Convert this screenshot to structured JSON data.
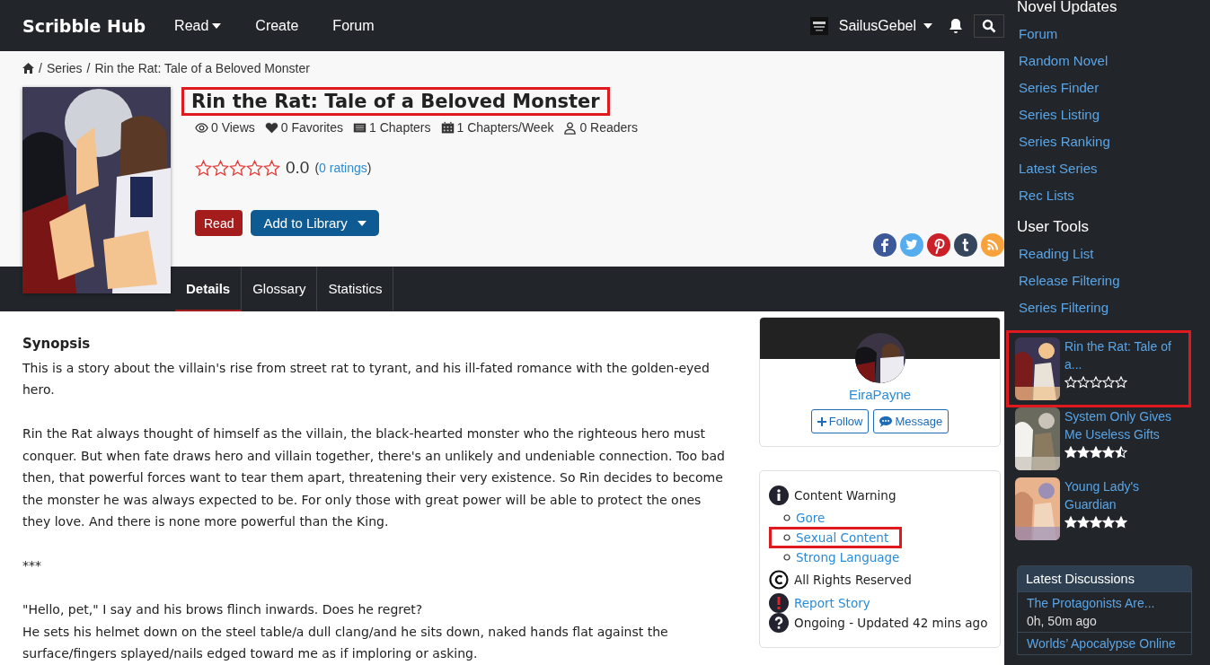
{
  "nav": {
    "brand": "Scribble Hub",
    "menu": [
      {
        "label": "Read",
        "dropdown": true
      },
      {
        "label": "Create",
        "dropdown": false
      },
      {
        "label": "Forum",
        "dropdown": false
      }
    ],
    "user": "SailusGebel"
  },
  "breadcrumb": [
    {
      "separator": "/",
      "label": "Series"
    },
    {
      "separator": "/",
      "label": "Rin the Rat: Tale of a Beloved Monster"
    }
  ],
  "series": {
    "title": "Rin the Rat: Tale of a Beloved Monster",
    "highlighted": true,
    "stats": [
      {
        "kind": "views",
        "text": "0 Views"
      },
      {
        "kind": "favorites",
        "text": "0 Favorites"
      },
      {
        "kind": "chapters",
        "text": "1 Chapters"
      },
      {
        "kind": "schedule",
        "text": "1 Chapters/Week"
      },
      {
        "kind": "readers",
        "text": "0 Readers"
      }
    ],
    "stars": 0,
    "rating": "0.0",
    "ratings_open": "(",
    "ratings_link": "0 ratings",
    "ratings_close": ")",
    "read_button": "Read",
    "library_button": "Add to Library"
  },
  "tabs": [
    {
      "label": "Details",
      "selected": true
    },
    {
      "label": "Glossary",
      "selected": false
    },
    {
      "label": "Statistics",
      "selected": false
    }
  ],
  "synopsis": {
    "heading": "Synopsis",
    "paragraphs": [
      [
        "This is a story about the villain's rise from street rat to tyrant, and his ill-fated romance with the golden-eyed hero."
      ],
      [
        "Rin the Rat always thought of himself as the villain, the black-hearted monster who the righteous hero must conquer. But when fate draws hero and villain together, there's an unlikely and undeniable connection. Too bad then, that powerful forces want to tear them apart, threatening their very existence. So Rin decides to become the monster he was always expected to be. For only those with great power will be able to protect the ones they love. And there is none more powerful than the King."
      ],
      [
        "***"
      ],
      [
        "\"Hello, pet,\" I say and his brows flinch inwards. Does he regret?",
        "He sets his helmet down on the steel table/a dull clang/and he sits down, naked hands flat against the surface/fingers splayed/nails edged toward me as if imploring or asking."
      ]
    ]
  },
  "author": {
    "name": "EiraPayne",
    "follow": "Follow",
    "message": "Message"
  },
  "info": {
    "warning_title": "Content Warning",
    "warnings": [
      {
        "label": "Gore",
        "highlighted": false
      },
      {
        "label": "Sexual Content",
        "highlighted": true
      },
      {
        "label": "Strong Language",
        "highlighted": false
      }
    ],
    "license": "All Rights Reserved",
    "report": "Report Story",
    "status": "Ongoing - Updated 42 mins ago"
  },
  "sidebar": {
    "sections": [
      {
        "heading": "Novel Updates",
        "links": [
          "Forum",
          "Random Novel",
          "Series Finder",
          "Series Listing",
          "Series Ranking",
          "Latest Series",
          "Rec Lists"
        ]
      },
      {
        "heading": "User Tools",
        "links": [
          "Reading List",
          "Release Filtering",
          "Series Filtering"
        ]
      }
    ],
    "novels": [
      {
        "title": "Rin the Rat: Tale of a...",
        "stars": 0,
        "highlighted": true
      },
      {
        "title": "System Only Gives Me Useless Gifts",
        "stars": 4.5,
        "highlighted": false
      },
      {
        "title": "Young Lady's Guardian",
        "stars": 5,
        "highlighted": false
      }
    ],
    "discussions": {
      "heading": "Latest Discussions",
      "items": [
        {
          "title": "The Protagonists Are...",
          "time": "0h, 50m ago"
        },
        {
          "title": "Worlds’ Apocalypse Online"
        }
      ]
    }
  }
}
